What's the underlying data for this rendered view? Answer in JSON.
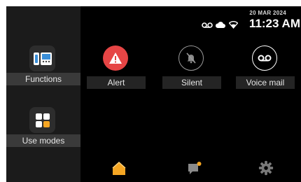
{
  "status_bar": {
    "date": "20 MAR 2024",
    "time": "11:23 AM",
    "icons": [
      "voicemail-icon",
      "cloud-icon",
      "wifi-icon"
    ]
  },
  "sidebar": {
    "items": [
      {
        "label": "Functions",
        "icon": "intercom-phone-icon"
      },
      {
        "label": "Use modes",
        "icon": "use-modes-grid-icon"
      }
    ]
  },
  "quick_actions": [
    {
      "label": "Alert",
      "icon": "alert-triangle-icon",
      "color": "#e64545"
    },
    {
      "label": "Silent",
      "icon": "bell-muted-icon",
      "color": "#9a9a9a"
    },
    {
      "label": "Voice mail",
      "icon": "voicemail-icon",
      "color": "#ffffff"
    }
  ],
  "bottom_nav": {
    "items": [
      "home-icon",
      "messages-icon",
      "settings-icon"
    ],
    "accent": "#f5a623"
  }
}
